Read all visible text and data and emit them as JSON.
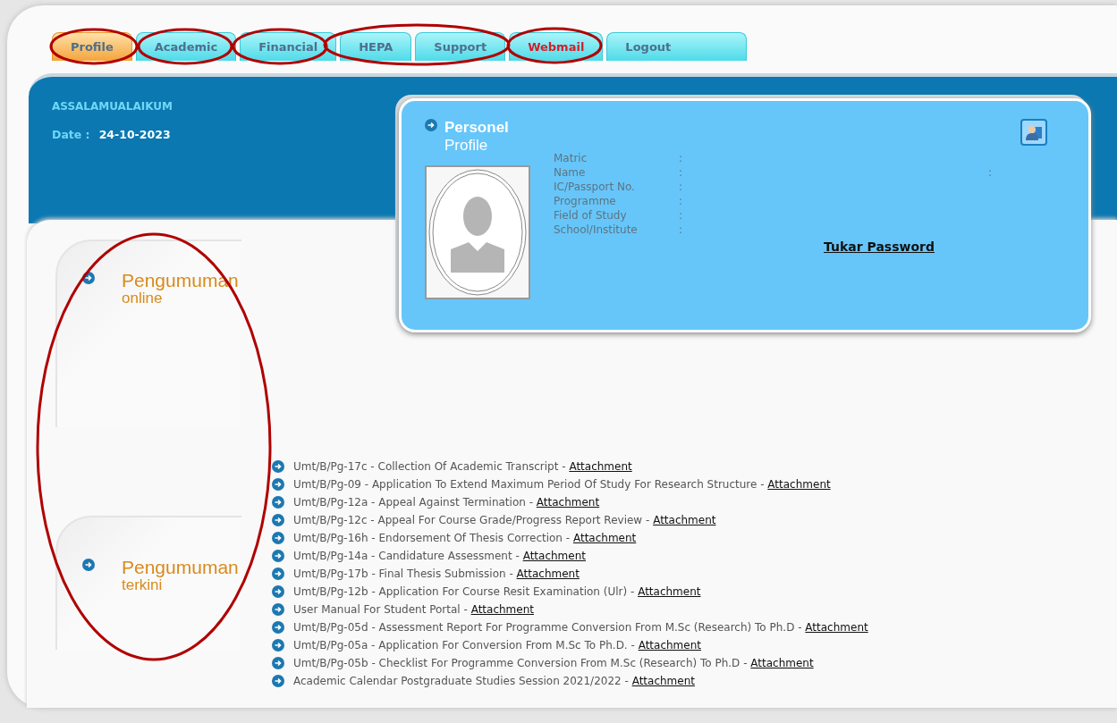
{
  "tabs": [
    {
      "label": "Profile",
      "selected": true,
      "alert": false
    },
    {
      "label": "Academic",
      "selected": false,
      "alert": false
    },
    {
      "label": "Financial",
      "selected": false,
      "alert": false
    },
    {
      "label": "HEPA",
      "selected": false,
      "alert": false
    },
    {
      "label": "Support",
      "selected": false,
      "alert": false
    },
    {
      "label": "Webmail",
      "selected": false,
      "alert": true
    },
    {
      "label": "Logout",
      "selected": false,
      "alert": false
    }
  ],
  "header": {
    "greeting": "ASSALAMUALAIKUM",
    "date_label": "Date :",
    "date": "24-10-2023"
  },
  "profile": {
    "title": "Personel",
    "subtitle": "Profile",
    "fields": [
      {
        "label": "Matric",
        "separator": ":"
      },
      {
        "label": "Name",
        "separator": ":",
        "trailing": ":"
      },
      {
        "label": "IC/Passport No.",
        "separator": ":"
      },
      {
        "label": "Programme",
        "separator": ":"
      },
      {
        "label": "Field of Study",
        "separator": ":"
      },
      {
        "label": "School/Institute",
        "separator": ":"
      }
    ],
    "link": "Tukar Password"
  },
  "sections": [
    {
      "title": "Pengumuman",
      "subtitle": "online"
    },
    {
      "title": "Pengumuman",
      "subtitle": "terkini",
      "items": [
        {
          "text": "Umt/B/Pg-17c - Collection Of Academic Transcript - ",
          "link": "Attachment"
        },
        {
          "text": "Umt/B/Pg-09 - Application To Extend Maximum Period Of Study For Research Structure - ",
          "link": "Attachment"
        },
        {
          "text": "Umt/B/Pg-12a - Appeal Against Termination - ",
          "link": "Attachment"
        },
        {
          "text": "Umt/B/Pg-12c - Appeal For Course Grade/Progress Report Review - ",
          "link": "Attachment"
        },
        {
          "text": "Umt/B/Pg-16h - Endorsement Of Thesis Correction - ",
          "link": "Attachment"
        },
        {
          "text": "Umt/B/Pg-14a - Candidature Assessment - ",
          "link": "Attachment"
        },
        {
          "text": "Umt/B/Pg-17b - Final Thesis Submission - ",
          "link": "Attachment"
        },
        {
          "text": "Umt/B/Pg-12b - Application For Course Resit Examination (Ulr) - ",
          "link": "Attachment"
        },
        {
          "text": "User Manual For Student Portal - ",
          "link": "Attachment"
        },
        {
          "text": "Umt/B/Pg-05d - Assessment Report For Programme Conversion From M.Sc (Research) To Ph.D - ",
          "link": "Attachment"
        },
        {
          "text": "Umt/B/Pg-05a - Application For Conversion From M.Sc To Ph.D. - ",
          "link": "Attachment"
        },
        {
          "text": "Umt/B/Pg-05b - Checklist For Programme Conversion From M.Sc (Research) To Ph.D - ",
          "link": "Attachment"
        },
        {
          "text": "Academic Calendar Postgraduate Studies Session 2021/2022 - ",
          "link": "Attachment"
        }
      ]
    }
  ],
  "annotations": [
    {
      "kind": "ellipse",
      "color": "#b00000"
    },
    {
      "kind": "ellipse",
      "color": "#b00000"
    },
    {
      "kind": "ellipse",
      "color": "#b00000"
    },
    {
      "kind": "ellipse",
      "color": "#b00000"
    },
    {
      "kind": "ellipse",
      "color": "#b00000"
    },
    {
      "kind": "ellipse",
      "color": "#b00000"
    }
  ]
}
